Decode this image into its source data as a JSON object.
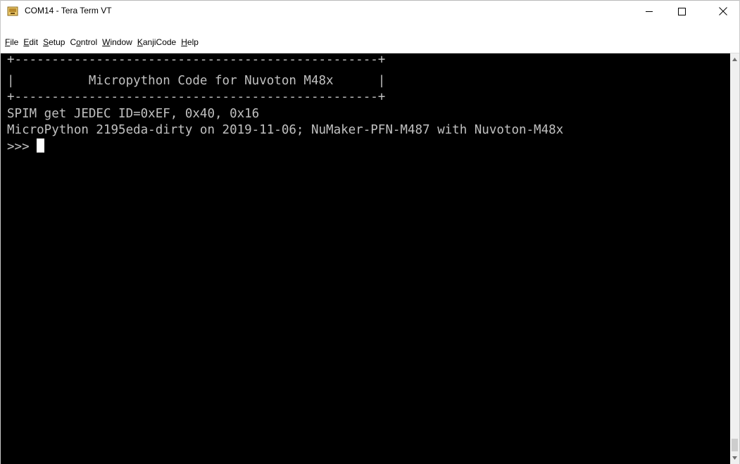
{
  "window": {
    "title": "COM14 - Tera Term VT",
    "minimize_glyph": "—",
    "maximize_glyph": "☐",
    "close_glyph": "✕"
  },
  "menu": {
    "items": [
      {
        "label": "File",
        "mnemonic": "F",
        "rest": "ile"
      },
      {
        "label": "Edit",
        "mnemonic": "E",
        "rest": "dit"
      },
      {
        "label": "Setup",
        "mnemonic": "S",
        "rest": "etup"
      },
      {
        "label": "Control",
        "pre": "C",
        "mnemonic": "o",
        "rest": "ntrol"
      },
      {
        "label": "Window",
        "mnemonic": "W",
        "rest": "indow"
      },
      {
        "label": "KanjiCode",
        "mnemonic": "K",
        "rest": "anjiCode"
      },
      {
        "label": "Help",
        "mnemonic": "H",
        "rest": "elp"
      }
    ]
  },
  "terminal": {
    "lines": [
      "+-------------------------------------------------+",
      "|          Micropython Code for Nuvoton M48x      |",
      "+-------------------------------------------------+",
      "SPIM get JEDEC ID=0xEF, 0x40, 0x16",
      "MicroPython 2195eda-dirty on 2019-11-06; NuMaker-PFN-M487 with Nuvoton-M48x"
    ],
    "prompt": ">>> "
  },
  "colors": {
    "terminal_bg": "#000000",
    "terminal_fg": "#c0c0c0",
    "cursor": "#ffffff"
  }
}
